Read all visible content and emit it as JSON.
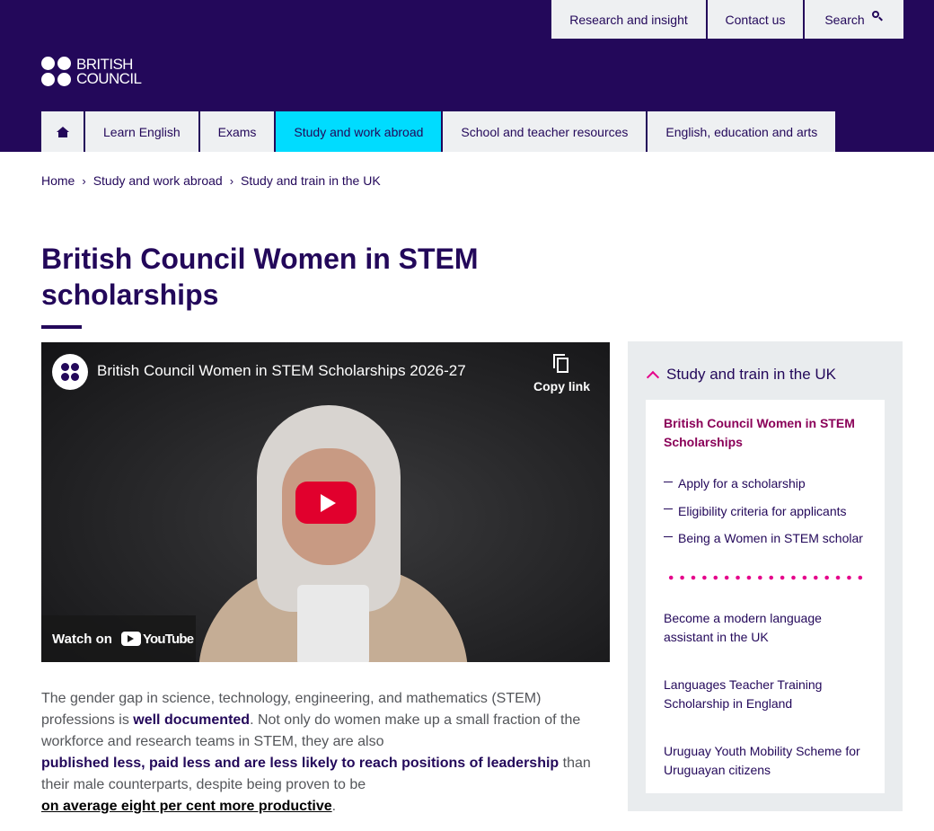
{
  "utility_nav": {
    "research": "Research and insight",
    "contact": "Contact us",
    "search": "Search"
  },
  "logo": {
    "line1": "BRITISH",
    "line2": "COUNCIL"
  },
  "main_nav": {
    "items": [
      {
        "label": "Learn English"
      },
      {
        "label": "Exams"
      },
      {
        "label": "Study and work abroad",
        "active": true
      },
      {
        "label": "School and teacher resources"
      },
      {
        "label": "English, education and arts"
      }
    ]
  },
  "breadcrumb": {
    "items": [
      "Home",
      "Study and work abroad",
      "Study and train in the UK"
    ],
    "separator": "›"
  },
  "page": {
    "title": "British Council Women in STEM scholarships"
  },
  "video": {
    "title": "British Council Women in STEM Scholarships 2026-27",
    "copy_link": "Copy link",
    "watch_on": "Watch on",
    "platform": "YouTube"
  },
  "body": {
    "t1": "The gender gap in science, technology, engineering, and mathematics (STEM) professions is ",
    "link1": "well documented",
    "t2": ". Not only do women make up a small fraction of the workforce and research teams in STEM, they are also ",
    "link2": "published less, paid less and are less likely to reach positions of leadership",
    "t3": " than their male counterparts, despite being proven to be ",
    "link3": "on average eight per cent more productive",
    "t4": "."
  },
  "sidebar": {
    "heading": "Study and train in the UK",
    "current": "British Council Women in STEM Scholarships",
    "sub_links": [
      "Apply for a scholarship",
      "Eligibility criteria for applicants",
      "Being a Women in STEM scholar"
    ],
    "other_links": [
      "Become a modern language assistant in the UK",
      "Languages Teacher Training Scholarship in England",
      "Uruguay Youth Mobility Scheme for Uruguayan citizens"
    ]
  },
  "colors": {
    "brand_purple": "#23085a",
    "active_tab": "#00dcff",
    "accent_pink": "#e5008a",
    "sidebar_current": "#8a0058",
    "youtube_red": "#e1002d"
  }
}
